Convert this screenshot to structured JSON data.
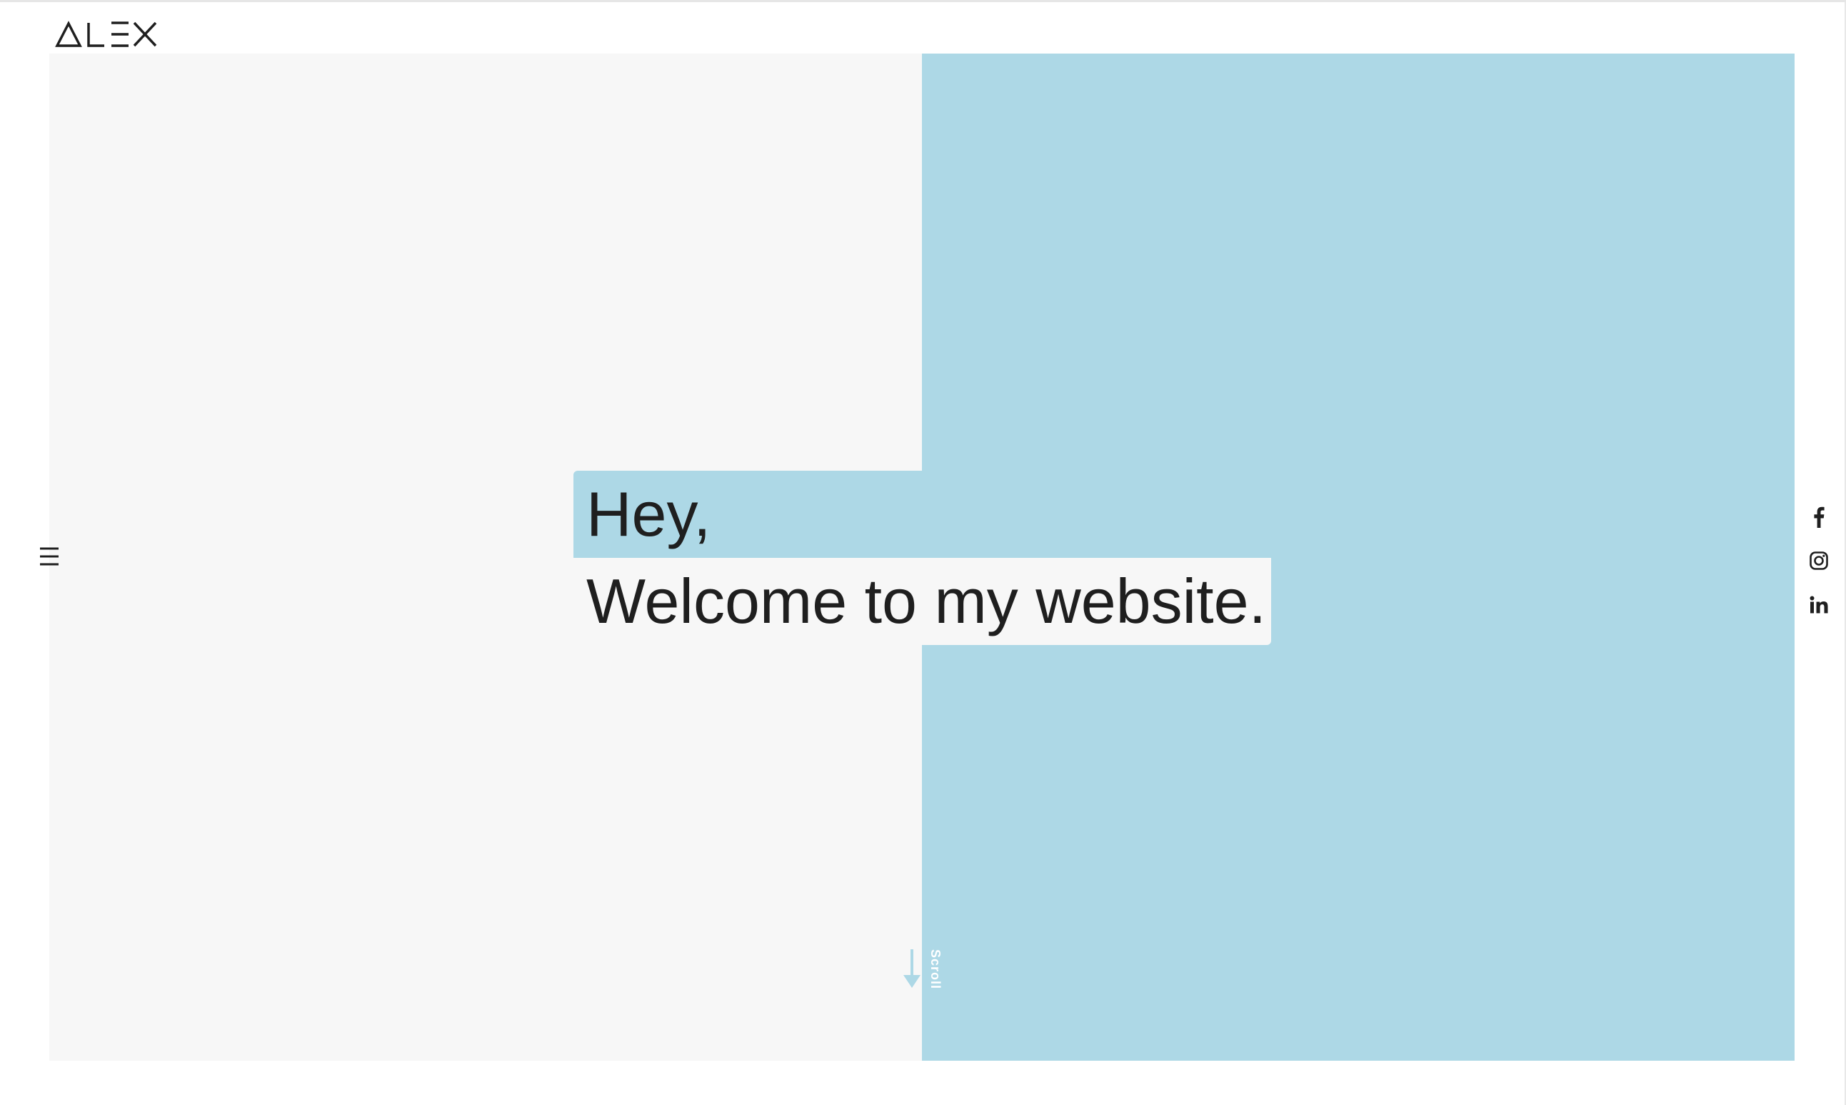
{
  "brand": {
    "logo_text": "ALEX"
  },
  "hero": {
    "headline_line_1": "Hey,",
    "headline_line_2": "Welcome to my website.",
    "scroll_label": "Scroll"
  },
  "menu": {
    "toggle_icon": "hamburger-icon"
  },
  "social": {
    "items": [
      {
        "icon": "facebook-icon"
      },
      {
        "icon": "instagram-icon"
      },
      {
        "icon": "linkedin-icon"
      }
    ]
  },
  "colors": {
    "accent": "#add8e6",
    "panel_light": "#f7f7f7",
    "text": "#1f1f1f",
    "page_background": "#ffffff"
  }
}
